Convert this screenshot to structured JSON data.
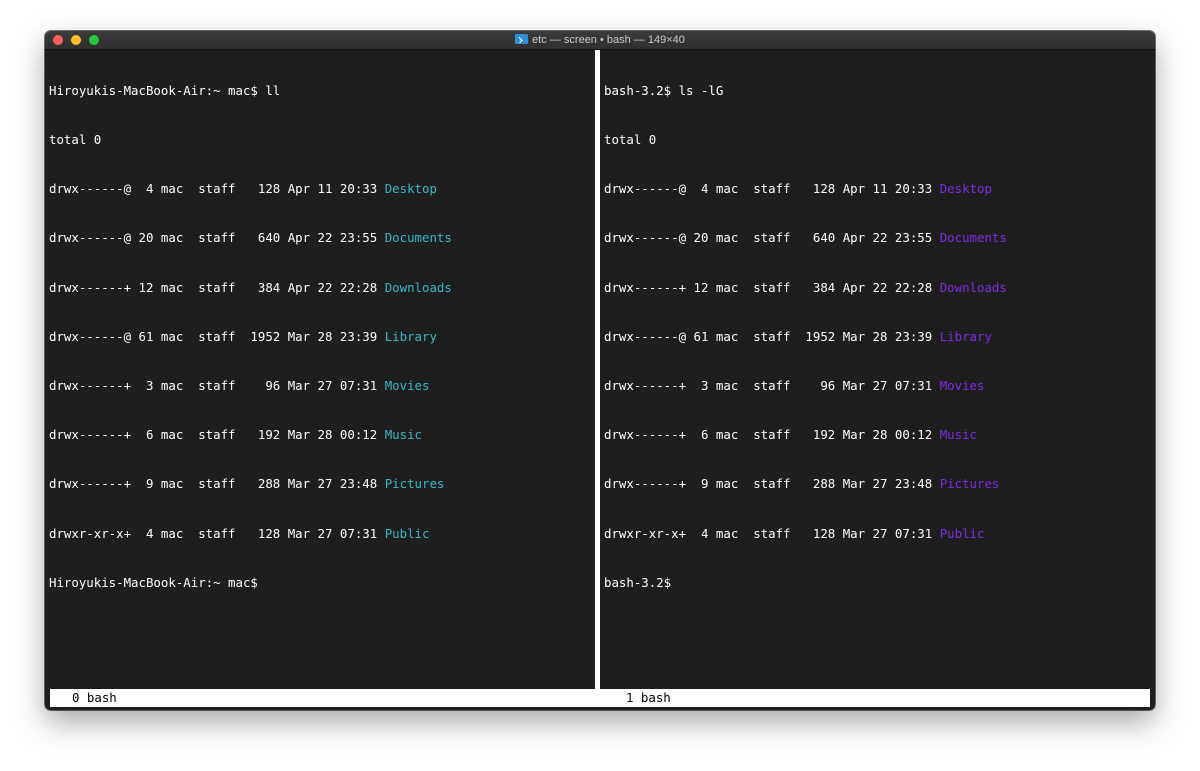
{
  "window": {
    "title": "etc — screen • bash — 149×40",
    "title_icon": "terminal-icon"
  },
  "colors": {
    "background": "#1e1e1e",
    "text": "#ffffff",
    "dir_left": "#35b8c6",
    "dir_right": "#7a2be0",
    "status_bg": "#ffffff"
  },
  "left_pane": {
    "prompt_command": "Hiroyukis-MacBook-Air:~ mac$ ll",
    "total": "total 0",
    "entries": [
      {
        "info": "drwx------@  4 mac  staff   128 Apr 11 20:33 ",
        "name": "Desktop"
      },
      {
        "info": "drwx------@ 20 mac  staff   640 Apr 22 23:55 ",
        "name": "Documents"
      },
      {
        "info": "drwx------+ 12 mac  staff   384 Apr 22 22:28 ",
        "name": "Downloads"
      },
      {
        "info": "drwx------@ 61 mac  staff  1952 Mar 28 23:39 ",
        "name": "Library"
      },
      {
        "info": "drwx------+  3 mac  staff    96 Mar 27 07:31 ",
        "name": "Movies"
      },
      {
        "info": "drwx------+  6 mac  staff   192 Mar 28 00:12 ",
        "name": "Music"
      },
      {
        "info": "drwx------+  9 mac  staff   288 Mar 27 23:48 ",
        "name": "Pictures"
      },
      {
        "info": "drwxr-xr-x+  4 mac  staff   128 Mar 27 07:31 ",
        "name": "Public"
      }
    ],
    "prompt_end": "Hiroyukis-MacBook-Air:~ mac$"
  },
  "right_pane": {
    "prompt_command": "bash-3.2$ ls -lG",
    "total": "total 0",
    "entries": [
      {
        "info": "drwx------@  4 mac  staff   128 Apr 11 20:33 ",
        "name": "Desktop"
      },
      {
        "info": "drwx------@ 20 mac  staff   640 Apr 22 23:55 ",
        "name": "Documents"
      },
      {
        "info": "drwx------+ 12 mac  staff   384 Apr 22 22:28 ",
        "name": "Downloads"
      },
      {
        "info": "drwx------@ 61 mac  staff  1952 Mar 28 23:39 ",
        "name": "Library"
      },
      {
        "info": "drwx------+  3 mac  staff    96 Mar 27 07:31 ",
        "name": "Movies"
      },
      {
        "info": "drwx------+  6 mac  staff   192 Mar 28 00:12 ",
        "name": "Music"
      },
      {
        "info": "drwx------+  9 mac  staff   288 Mar 27 23:48 ",
        "name": "Pictures"
      },
      {
        "info": "drwxr-xr-x+  4 mac  staff   128 Mar 27 07:31 ",
        "name": "Public"
      }
    ],
    "prompt_end": "bash-3.2$"
  },
  "status_bar": {
    "window_0": "0 bash",
    "window_1": "1 bash"
  }
}
